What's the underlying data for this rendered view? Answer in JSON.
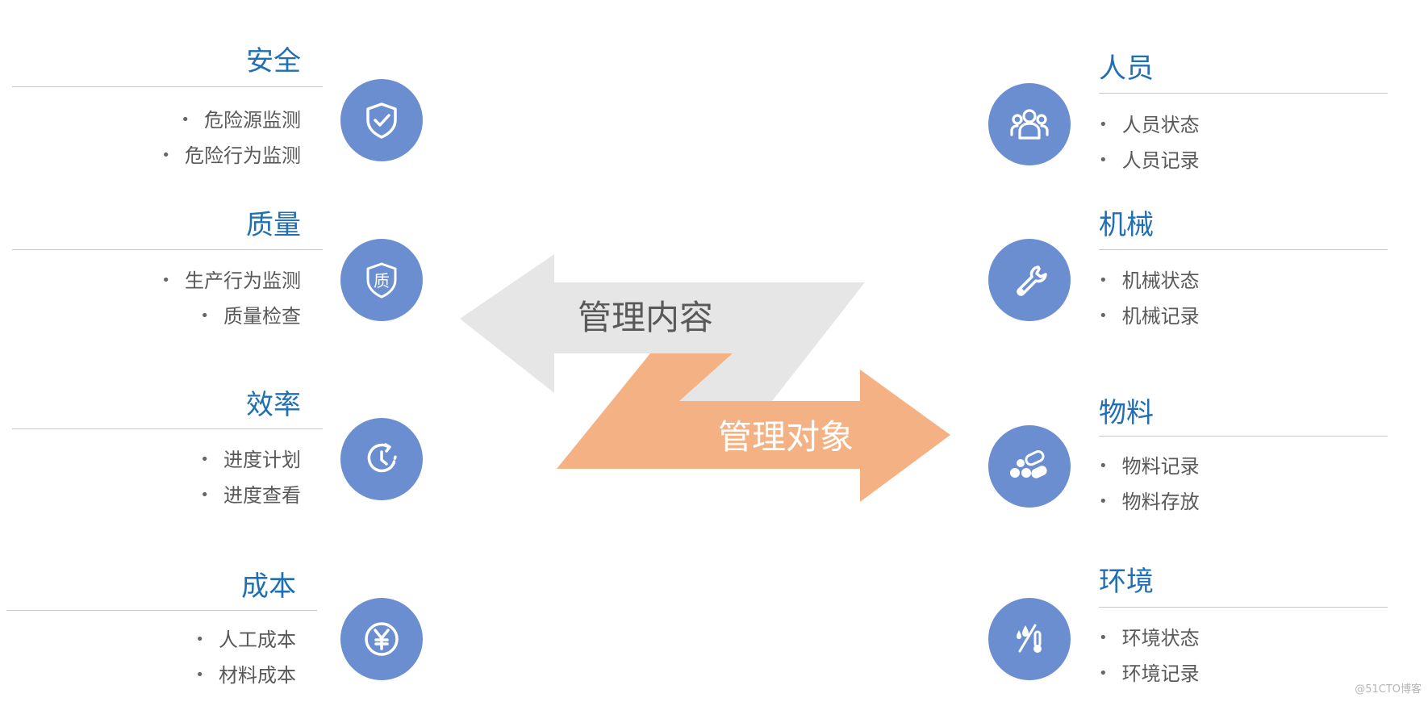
{
  "colors": {
    "title": "#1f6fb4",
    "circle": "#6a8ecf",
    "gray_arrow": "#e6e6e6",
    "orange_arrow": "#f4b183",
    "text": "#595959"
  },
  "left_groups": [
    {
      "title": "安全",
      "icon": "shield-check-icon",
      "items": [
        "危险源监测",
        "危险行为监测"
      ]
    },
    {
      "title": "质量",
      "icon": "quality-shield-icon",
      "items": [
        "生产行为监测",
        "质量检查"
      ]
    },
    {
      "title": "效率",
      "icon": "clock-icon",
      "items": [
        "进度计划",
        "进度查看"
      ]
    },
    {
      "title": "成本",
      "icon": "yen-icon",
      "items": [
        "人工成本",
        "材料成本"
      ]
    }
  ],
  "right_groups": [
    {
      "title": "人员",
      "icon": "people-icon",
      "items": [
        "人员状态",
        "人员记录"
      ]
    },
    {
      "title": "机械",
      "icon": "wrench-icon",
      "items": [
        "机械状态",
        "机械记录"
      ]
    },
    {
      "title": "物料",
      "icon": "materials-icon",
      "items": [
        "物料记录",
        "物料存放"
      ]
    },
    {
      "title": "环境",
      "icon": "environment-icon",
      "items": [
        "环境状态",
        "环境记录"
      ]
    }
  ],
  "arrows": {
    "left_label": "管理内容",
    "right_label": "管理对象"
  },
  "watermark": "@51CTO博客"
}
